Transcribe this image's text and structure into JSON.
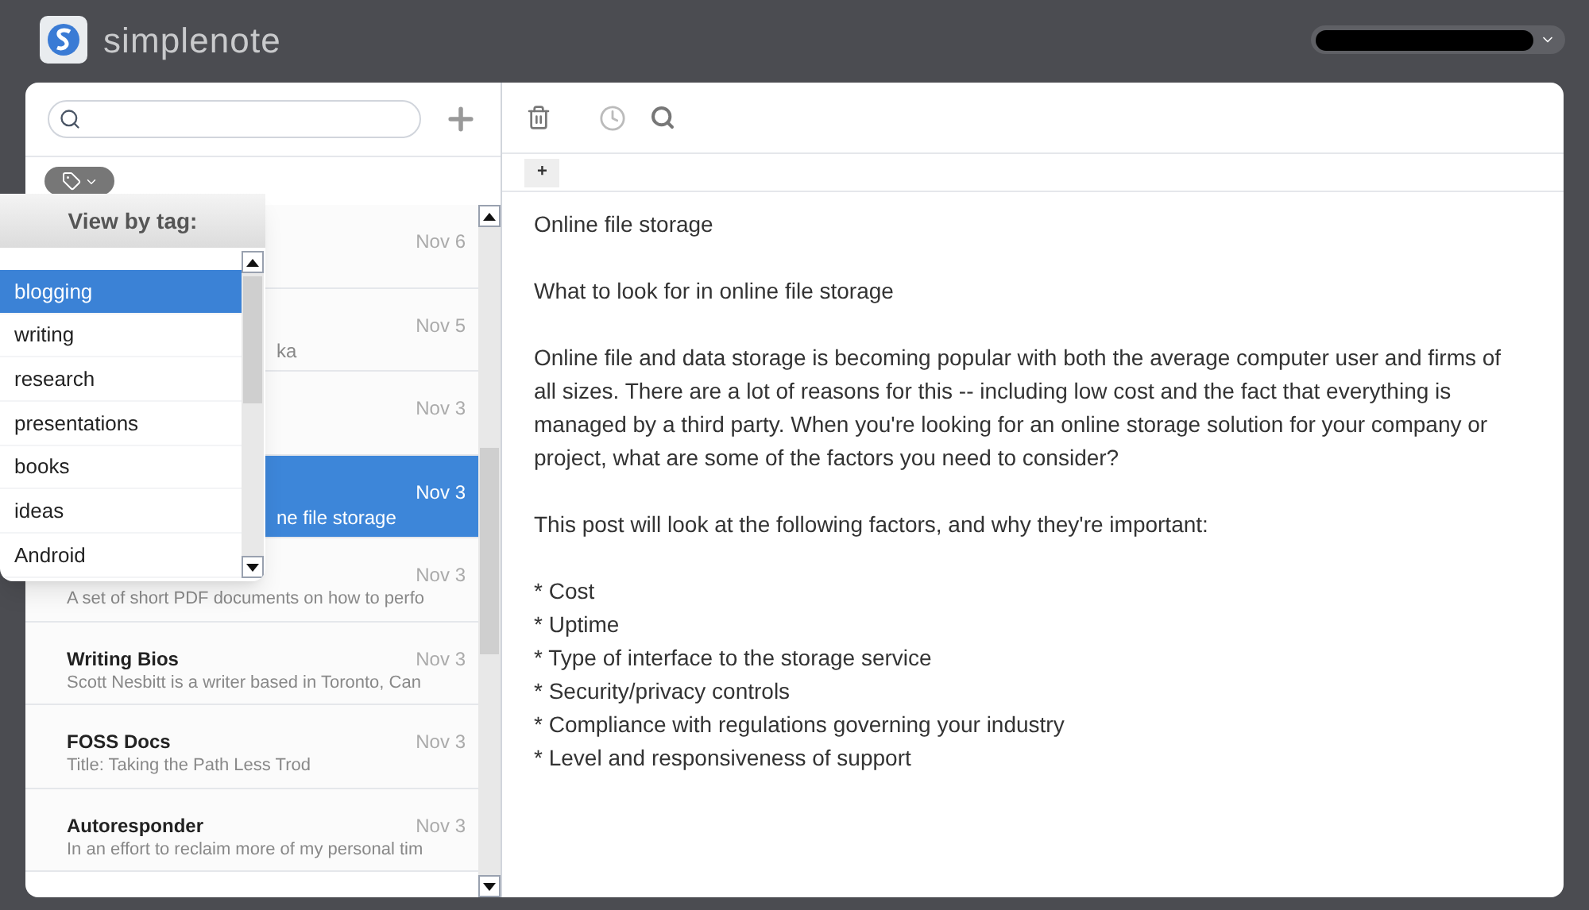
{
  "app": {
    "name": "simplenote"
  },
  "tag_menu": {
    "title": "View by tag:",
    "items": [
      {
        "label": "blogging",
        "selected": true
      },
      {
        "label": "writing",
        "selected": false
      },
      {
        "label": "research",
        "selected": false
      },
      {
        "label": "presentations",
        "selected": false
      },
      {
        "label": "books",
        "selected": false
      },
      {
        "label": "ideas",
        "selected": false
      },
      {
        "label": "Android",
        "selected": false
      }
    ]
  },
  "notes": [
    {
      "date": "Nov 6",
      "selected": false
    },
    {
      "date": "Nov 5",
      "preview": "ka",
      "selected": false,
      "kind": "covered"
    },
    {
      "date": "Nov 3",
      "selected": false
    },
    {
      "date": "Nov 3",
      "preview": "ne file storage",
      "selected": true,
      "kind": "covered"
    },
    {
      "date": "Nov 3",
      "preview": "A set of short PDF documents on how to perfo",
      "selected": false,
      "kind": "plain"
    },
    {
      "title": "Writing Bios",
      "date": "Nov 3",
      "preview": "Scott Nesbitt is a writer based in Toronto, Can",
      "selected": false,
      "kind": "plain"
    },
    {
      "title": "FOSS Docs",
      "date": "Nov 3",
      "preview": "Title: Taking the Path Less Trod",
      "selected": false,
      "kind": "plain"
    },
    {
      "title": "Autoresponder",
      "date": "Nov 3",
      "preview": "In an effort to reclaim more of my personal tim",
      "selected": false,
      "kind": "plain"
    }
  ],
  "editor": {
    "tag_add": "+",
    "paragraphs": [
      [
        "Online file storage"
      ],
      [
        "What to look for in online file storage"
      ],
      [
        "Online file and data storage is becoming popular with both the average computer user and firms of all sizes. There are a lot of reasons for this -- including low cost and the fact that everything is managed by a third party. When you're looking for an online storage solution for your company or project, what are some of the factors you need to consider?"
      ],
      [
        "This post will look at the following factors, and why they're important:"
      ],
      [
        "* Cost",
        "* Uptime",
        "* Type of interface to the storage service",
        "* Security/privacy controls",
        "* Compliance with regulations governing your industry",
        "* Level and responsiveness of support"
      ]
    ]
  }
}
